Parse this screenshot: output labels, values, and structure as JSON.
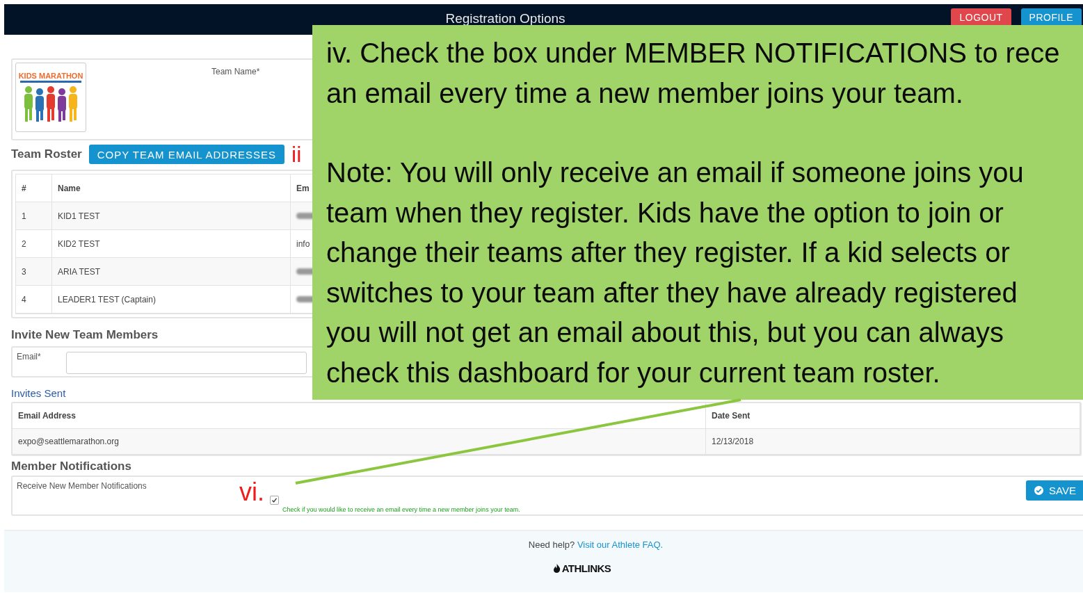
{
  "header": {
    "title": "Registration Options",
    "buttons": [
      {
        "label": "LOGOUT",
        "kind": "danger"
      },
      {
        "label": "PROFILE",
        "kind": "primary"
      }
    ]
  },
  "team": {
    "logo_text": "KIDS MARATHON",
    "name_label": "Team Name*"
  },
  "roster": {
    "heading": "Team Roster",
    "copy_button": "COPY TEAM EMAIL ADDRESSES",
    "marker": "ii",
    "columns": [
      "#",
      "Name",
      "Em"
    ],
    "rows": [
      {
        "number": "1",
        "name": "KID1 TEST",
        "email": {
          "kind": "blurred"
        }
      },
      {
        "number": "2",
        "name": "KID2 TEST",
        "email": {
          "kind": "text",
          "text": "info"
        }
      },
      {
        "number": "3",
        "name": "ARIA TEST",
        "email": {
          "kind": "blurred"
        }
      },
      {
        "number": "4",
        "name": "LEADER1 TEST (Captain)",
        "email": {
          "kind": "blurred"
        }
      }
    ]
  },
  "invite": {
    "heading": "Invite New Team Members",
    "email_label": "Email*"
  },
  "invites_sent": {
    "link": "Invites Sent",
    "columns": [
      "Email Address",
      "Date Sent"
    ],
    "rows": [
      [
        "expo@seattlemarathon.org",
        "12/13/2018"
      ]
    ]
  },
  "notifications": {
    "heading": "Member Notifications",
    "label": "Receive New Member Notifications",
    "marker": "vi.",
    "checked": true,
    "help": "Check if you would like to receive an email every time a new member joins your team.",
    "save": "SAVE"
  },
  "footer": {
    "help_text": "Need help?",
    "link": "Visit our Athlete FAQ.",
    "brand": "ATHLINKS"
  },
  "callout": {
    "paragraphs": [
      [
        "iv. Check the box under MEMBER NOTIFICATIONS to rece",
        "an email every time a new member joins your team."
      ],
      [
        "Note: You will only receive an email if someone joins you",
        "team when they register. Kids have the option to join or",
        "change their teams after they register. If a kid selects or",
        "switches to your team after they have already registered",
        "you will not get an email about this, but you can always",
        "check this dashboard for your current team roster."
      ]
    ]
  }
}
